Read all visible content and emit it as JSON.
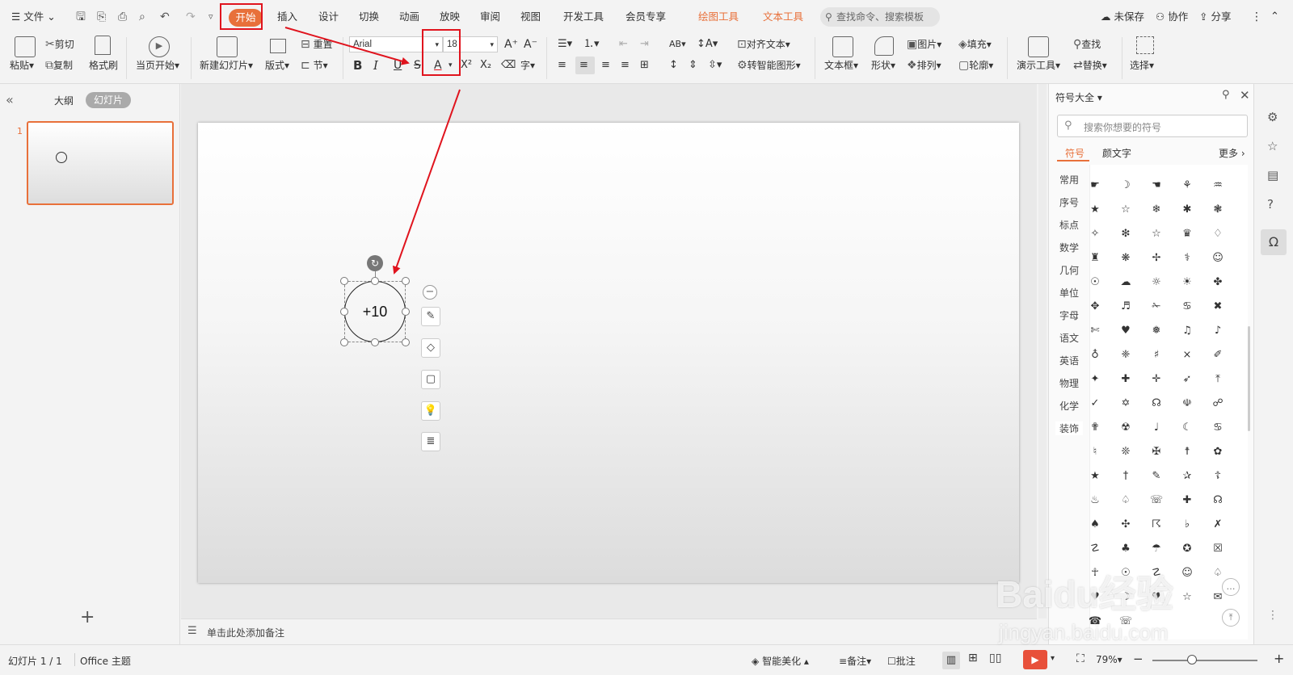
{
  "menu": {
    "file": "文件",
    "tabs": [
      {
        "label": "开始",
        "active": true
      },
      {
        "label": "插入"
      },
      {
        "label": "设计"
      },
      {
        "label": "切换"
      },
      {
        "label": "动画"
      },
      {
        "label": "放映"
      },
      {
        "label": "审阅"
      },
      {
        "label": "视图"
      },
      {
        "label": "开发工具"
      },
      {
        "label": "会员专享"
      },
      {
        "label": "绘图工具",
        "contextual": true
      },
      {
        "label": "文本工具",
        "contextual": true
      }
    ],
    "search_placeholder": "查找命令、搜索模板",
    "unsaved": "未保存",
    "collab": "协作",
    "share": "分享"
  },
  "ribbon": {
    "paste": "粘贴",
    "cut": "剪切",
    "copy": "复制",
    "format_painter": "格式刷",
    "from_current": "当页开始",
    "new_slide": "新建幻灯片",
    "layout": "版式",
    "reset": "重置",
    "section": "节",
    "font_name": "Arial",
    "font_size": "18",
    "align_text": "对齐文本",
    "smart_art": "转智能图形",
    "textbox": "文本框",
    "shape": "形状",
    "picture": "图片",
    "fill": "填充",
    "arrange": "排列",
    "outline": "轮廓",
    "present_tools": "演示工具",
    "find": "查找",
    "replace": "替换",
    "select": "选择"
  },
  "left_pane": {
    "outline_tab": "大纲",
    "slides_tab": "幻灯片",
    "slide_number": "1"
  },
  "slide": {
    "shape_text": "+10"
  },
  "notes_placeholder": "单击此处添加备注",
  "symbol_panel": {
    "title": "符号大全",
    "search_placeholder": "搜索你想要的符号",
    "tabs": [
      "符号",
      "颜文字"
    ],
    "more": "更多",
    "categories": [
      "常用",
      "序号",
      "标点",
      "数学",
      "几何",
      "单位",
      "字母",
      "语文",
      "英语",
      "物理",
      "化学",
      "装饰"
    ],
    "symbols": [
      "☛",
      "☽",
      "☚",
      "⚘",
      "♒",
      "★",
      "☆",
      "❄",
      "✱",
      "❃",
      "✧",
      "❇",
      "☆",
      "♛",
      "♢",
      "♜",
      "❋",
      "✢",
      "⚕",
      "☺",
      "☉",
      "☁",
      "☼",
      "☀",
      "✤",
      "✥",
      "♬",
      "✁",
      "♋",
      "✖",
      "✄",
      "♥",
      "❅",
      "♫",
      "♪",
      "♁",
      "❈",
      "♯",
      "⨯",
      "✐",
      "✦",
      "✚",
      "✛",
      "➶",
      "⤒",
      "✓",
      "✡",
      "☊",
      "☫",
      "☍",
      "✟",
      "☢",
      "♩",
      "☾",
      "♋",
      "♮",
      "❊",
      "✠",
      "☨",
      "✿",
      "★",
      "†",
      "✎",
      "✰",
      "☦",
      "♨",
      "♤",
      "☏",
      "✚",
      "☊",
      "♠",
      "✣",
      "☈",
      "♭",
      "✗",
      "☡",
      "♣",
      "☂",
      "✪",
      "☒",
      "☥",
      "☉",
      "☡",
      "☺",
      "♤",
      "♥",
      "☽",
      "♥",
      "☆",
      "✉",
      "☎",
      "☏",
      "",
      "",
      ""
    ]
  },
  "status": {
    "slide_count": "幻灯片 1 / 1",
    "theme": "Office 主题",
    "beautify": "智能美化",
    "notes": "备注",
    "comments": "批注",
    "zoom": "79%"
  },
  "watermark": {
    "brand": "Baidu经验",
    "url": "jingyan.baidu.com"
  },
  "colors": {
    "accent": "#e8703a",
    "annotation_red": "#e0141e"
  }
}
